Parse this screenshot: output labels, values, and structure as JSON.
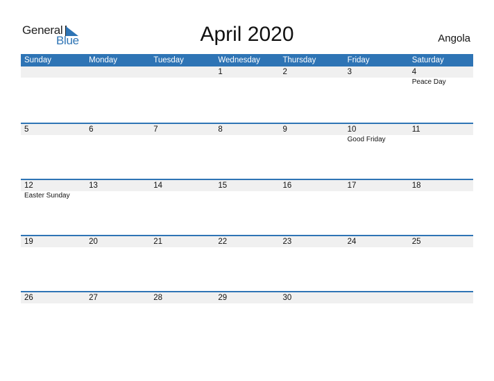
{
  "logo": {
    "general": "General",
    "blue": "Blue",
    "icon": "triangle-flag-icon"
  },
  "title": "April 2020",
  "country": "Angola",
  "colors": {
    "accent": "#2e74b5",
    "strip": "#f0f0f0"
  },
  "weekdays": [
    "Sunday",
    "Monday",
    "Tuesday",
    "Wednesday",
    "Thursday",
    "Friday",
    "Saturday"
  ],
  "weeks": [
    {
      "days": [
        "",
        "",
        "",
        "1",
        "2",
        "3",
        "4"
      ],
      "events": [
        "",
        "",
        "",
        "",
        "",
        "",
        "Peace Day"
      ]
    },
    {
      "days": [
        "5",
        "6",
        "7",
        "8",
        "9",
        "10",
        "11"
      ],
      "events": [
        "",
        "",
        "",
        "",
        "",
        "Good Friday",
        ""
      ]
    },
    {
      "days": [
        "12",
        "13",
        "14",
        "15",
        "16",
        "17",
        "18"
      ],
      "events": [
        "Easter Sunday",
        "",
        "",
        "",
        "",
        "",
        ""
      ]
    },
    {
      "days": [
        "19",
        "20",
        "21",
        "22",
        "23",
        "24",
        "25"
      ],
      "events": [
        "",
        "",
        "",
        "",
        "",
        "",
        ""
      ]
    },
    {
      "days": [
        "26",
        "27",
        "28",
        "29",
        "30",
        "",
        ""
      ],
      "events": [
        "",
        "",
        "",
        "",
        "",
        "",
        ""
      ]
    }
  ]
}
